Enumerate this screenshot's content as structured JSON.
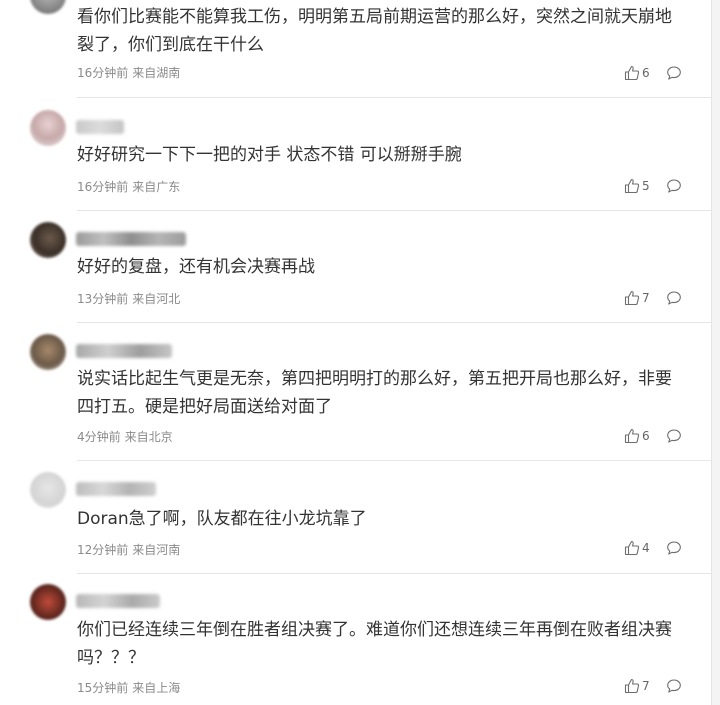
{
  "comments": [
    {
      "text": "看你们比赛能不能算我工伤，明明第五局前期运营的那么好，突然之间就天崩地裂了，你们到底在干什么",
      "time": "16分钟前",
      "location": "来自湖南",
      "likes": "6",
      "icons": {
        "like": "thumb-up-icon",
        "reply": "comment-bubble-icon"
      }
    },
    {
      "text": "好好研究一下下一把的对手 状态不错 可以掰掰手腕",
      "time": "16分钟前",
      "location": "来自广东",
      "likes": "5"
    },
    {
      "text": "好好的复盘，还有机会决赛再战",
      "time": "13分钟前",
      "location": "来自河北",
      "likes": "7"
    },
    {
      "text": "说实话比起生气更是无奈，第四把明明打的那么好，第五把开局也那么好，非要四打五。硬是把好局面送给对面了",
      "time": "4分钟前",
      "location": "来自北京",
      "likes": "6"
    },
    {
      "text": "Doran急了啊，队友都在往小龙坑靠了",
      "time": "12分钟前",
      "location": "来自河南",
      "likes": "4"
    },
    {
      "text": "你们已经连续三年倒在胜者组决赛了。难道你们还想连续三年再倒在败者组决赛吗？？？",
      "time": "15分钟前",
      "location": "来自上海",
      "likes": "7"
    }
  ],
  "colors": {
    "text": "#333333",
    "meta": "#8a8a8a",
    "divider": "#e6e6e6"
  }
}
